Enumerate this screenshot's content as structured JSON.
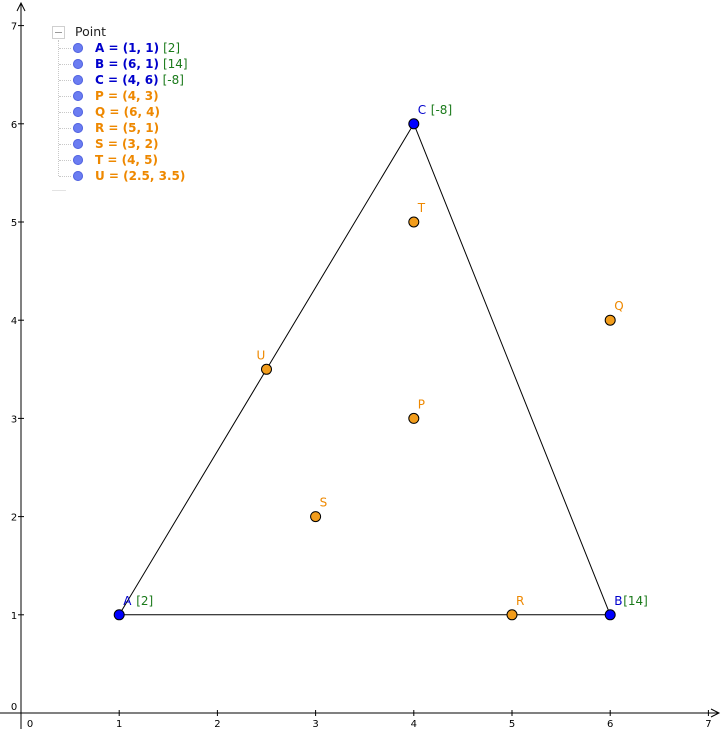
{
  "axes": {
    "x_ticks": [
      "0",
      "1",
      "2",
      "3",
      "4",
      "5",
      "6",
      "7"
    ],
    "y_ticks": [
      "0",
      "1",
      "2",
      "3",
      "4",
      "5",
      "6",
      "7"
    ],
    "xlim": [
      0,
      7
    ],
    "ylim": [
      0,
      7
    ],
    "grid": false
  },
  "algebra_view": {
    "header": "Point",
    "items": [
      {
        "text": "A = (1, 1)",
        "tag": "[2]",
        "color": "#0000cc"
      },
      {
        "text": "B = (6, 1)",
        "tag": "[14]",
        "color": "#0000cc"
      },
      {
        "text": "C = (4, 6)",
        "tag": "[-8]",
        "color": "#0000cc"
      },
      {
        "text": "P = (4, 3)",
        "tag": "",
        "color": "#ee8800"
      },
      {
        "text": "Q = (6, 4)",
        "tag": "",
        "color": "#ee8800"
      },
      {
        "text": "R = (5, 1)",
        "tag": "",
        "color": "#ee8800"
      },
      {
        "text": "S = (3, 2)",
        "tag": "",
        "color": "#ee8800"
      },
      {
        "text": "T = (4, 5)",
        "tag": "",
        "color": "#ee8800"
      },
      {
        "text": "U = (2.5, 3.5)",
        "tag": "",
        "color": "#ee8800"
      }
    ]
  },
  "points": [
    {
      "name": "A",
      "x": 1,
      "y": 1,
      "tag": "[2]",
      "color": "#0000ff",
      "labelColor": "#0000cc"
    },
    {
      "name": "B",
      "x": 6,
      "y": 1,
      "tag": "[14]",
      "color": "#0000ff",
      "labelColor": "#0000cc"
    },
    {
      "name": "C",
      "x": 4,
      "y": 6,
      "tag": "[-8]",
      "color": "#0000ff",
      "labelColor": "#0000cc"
    },
    {
      "name": "P",
      "x": 4,
      "y": 3,
      "tag": "",
      "color": "#f29d1c",
      "labelColor": "#ee8800"
    },
    {
      "name": "Q",
      "x": 6,
      "y": 4,
      "tag": "",
      "color": "#f29d1c",
      "labelColor": "#ee8800"
    },
    {
      "name": "R",
      "x": 5,
      "y": 1,
      "tag": "",
      "color": "#f29d1c",
      "labelColor": "#ee8800"
    },
    {
      "name": "S",
      "x": 3,
      "y": 2,
      "tag": "",
      "color": "#f29d1c",
      "labelColor": "#ee8800"
    },
    {
      "name": "T",
      "x": 4,
      "y": 5,
      "tag": "",
      "color": "#f29d1c",
      "labelColor": "#ee8800"
    },
    {
      "name": "U",
      "x": 2.5,
      "y": 3.5,
      "tag": "",
      "color": "#f29d1c",
      "labelColor": "#ee8800"
    }
  ],
  "triangle": [
    "A",
    "B",
    "C"
  ],
  "colors": {
    "tag": "#1a7a1a",
    "axis": "#000000",
    "segment": "#000000"
  }
}
